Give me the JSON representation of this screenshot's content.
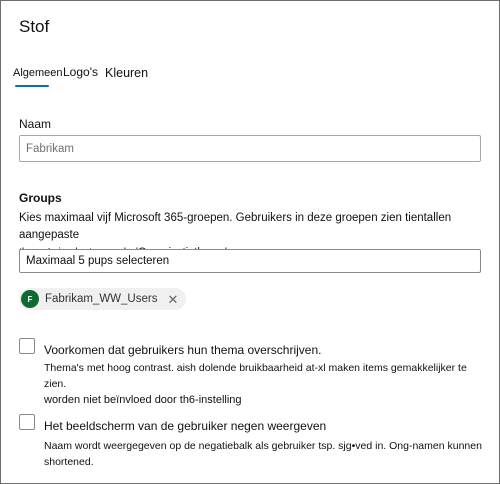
{
  "panel": {
    "title": "Stof"
  },
  "tabs": [
    {
      "label": "Algemeen",
      "selected": true
    },
    {
      "label": "Logo's",
      "selected": false
    },
    {
      "label": "Kleuren",
      "selected": false
    }
  ],
  "name_field": {
    "label": "Naam",
    "value": "Fabrikam"
  },
  "groups": {
    "label": "Groups",
    "description_line1": "Kies maximaal vijf Microsoft 365-groepen. Gebruikers in deze groepen zien tientallen aangepaste",
    "description_line2": "thema's in plaats van de",
    "description_quote": "'Organisatiethema'.",
    "select_value": "Maximaal 5 pups selecteren",
    "selected_group": {
      "initial": "F",
      "name": "Fabrikam_WW_Users",
      "avatar_color": "#0d6b32"
    },
    "remove_glyph": "✕"
  },
  "options": [
    {
      "label": "Voorkomen dat gebruikers hun thema overschrijven.",
      "help_line1": "Thema's met hoog contrast. aish dolende bruikbaarheid at-xl maken items gemakkelijker te zien.",
      "help_line2": "worden niet beïnvloed door th6-instelling",
      "checked": false
    },
    {
      "label": "Het beeldscherm van de gebruiker negen weergeven",
      "help_line1": "Naam wordt weergegeven op de negatiebalk als gebruiker tsp. sjg•ved in. Ong-namen kunnen",
      "help_line2": "shortened.",
      "checked": false
    }
  ],
  "colors": {
    "accent": "#0f6cbd",
    "border": "#a6a6a6"
  }
}
